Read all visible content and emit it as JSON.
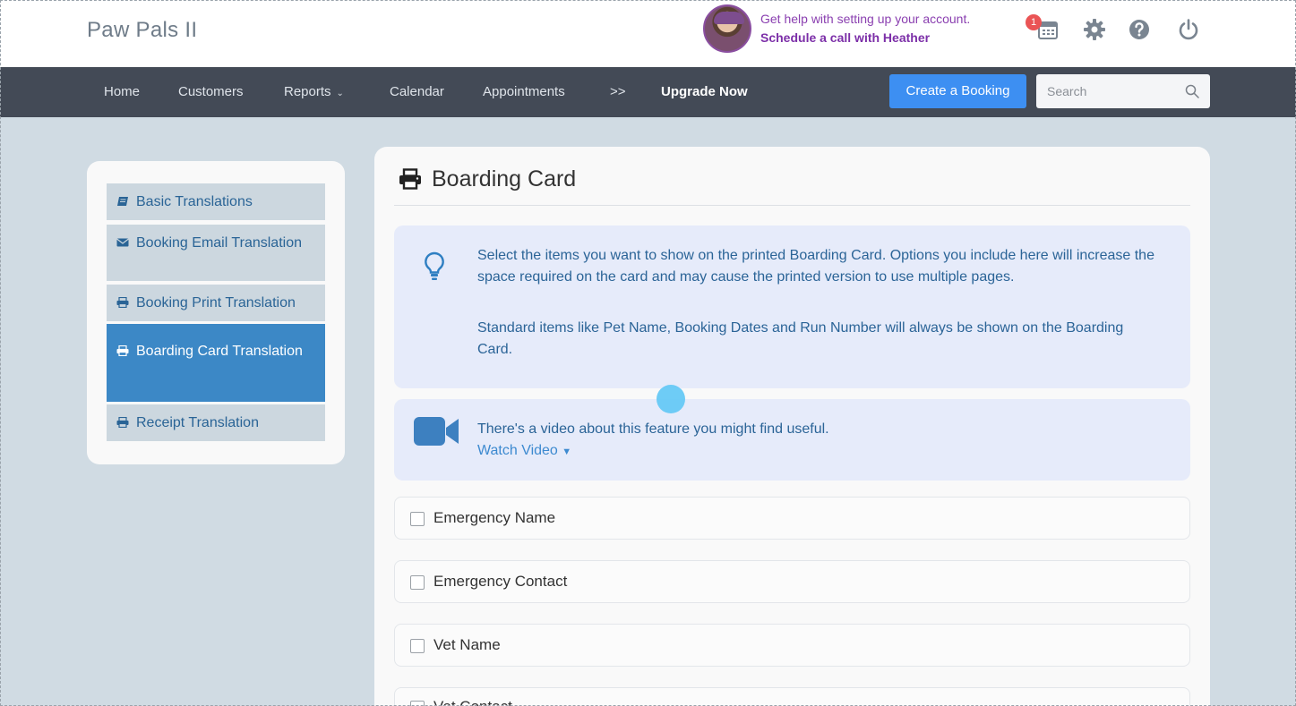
{
  "header": {
    "brand": "Paw Pals II",
    "help_line1": "Get help with setting up your account.",
    "help_line2": "Schedule a call with Heather",
    "notification_count": "1",
    "icons": [
      "calendar-icon",
      "gear-icon",
      "help-icon",
      "power-icon"
    ]
  },
  "nav": {
    "items": [
      "Home",
      "Customers",
      "Reports",
      "Calendar",
      "Appointments",
      ">>"
    ],
    "upgrade": "Upgrade Now",
    "create_booking": "Create a Booking",
    "search_placeholder": "Search"
  },
  "sidebar": {
    "items": [
      {
        "label": "Basic Translations",
        "icon": "book-icon"
      },
      {
        "label": "Booking Email Translation",
        "icon": "envelope-icon"
      },
      {
        "label": "Booking Print Translation",
        "icon": "print-icon"
      },
      {
        "label": "Boarding Card Translation",
        "icon": "print-icon",
        "active": true
      },
      {
        "label": "Receipt Translation",
        "icon": "print-icon"
      }
    ]
  },
  "main": {
    "title": "Boarding Card",
    "info_para1": "Select the items you want to show on the printed Boarding Card. Options you include here will increase the space required on the card and may cause the printed version to use multiple pages.",
    "info_para2": "Standard items like Pet Name, Booking Dates and Run Number will always be shown on the Boarding Card.",
    "video_text": "There's a video about this feature you might find useful.",
    "watch_video": "Watch Video",
    "options": [
      "Emergency Name",
      "Emergency Contact",
      "Vet Name",
      "Vet Contact"
    ]
  },
  "colors": {
    "nav_bg": "#434a56",
    "accent": "#3d8ff2",
    "sidebar_active": "#3c88c6",
    "info_bg": "#e6ebfa",
    "help_purple": "#8a3fb0"
  }
}
